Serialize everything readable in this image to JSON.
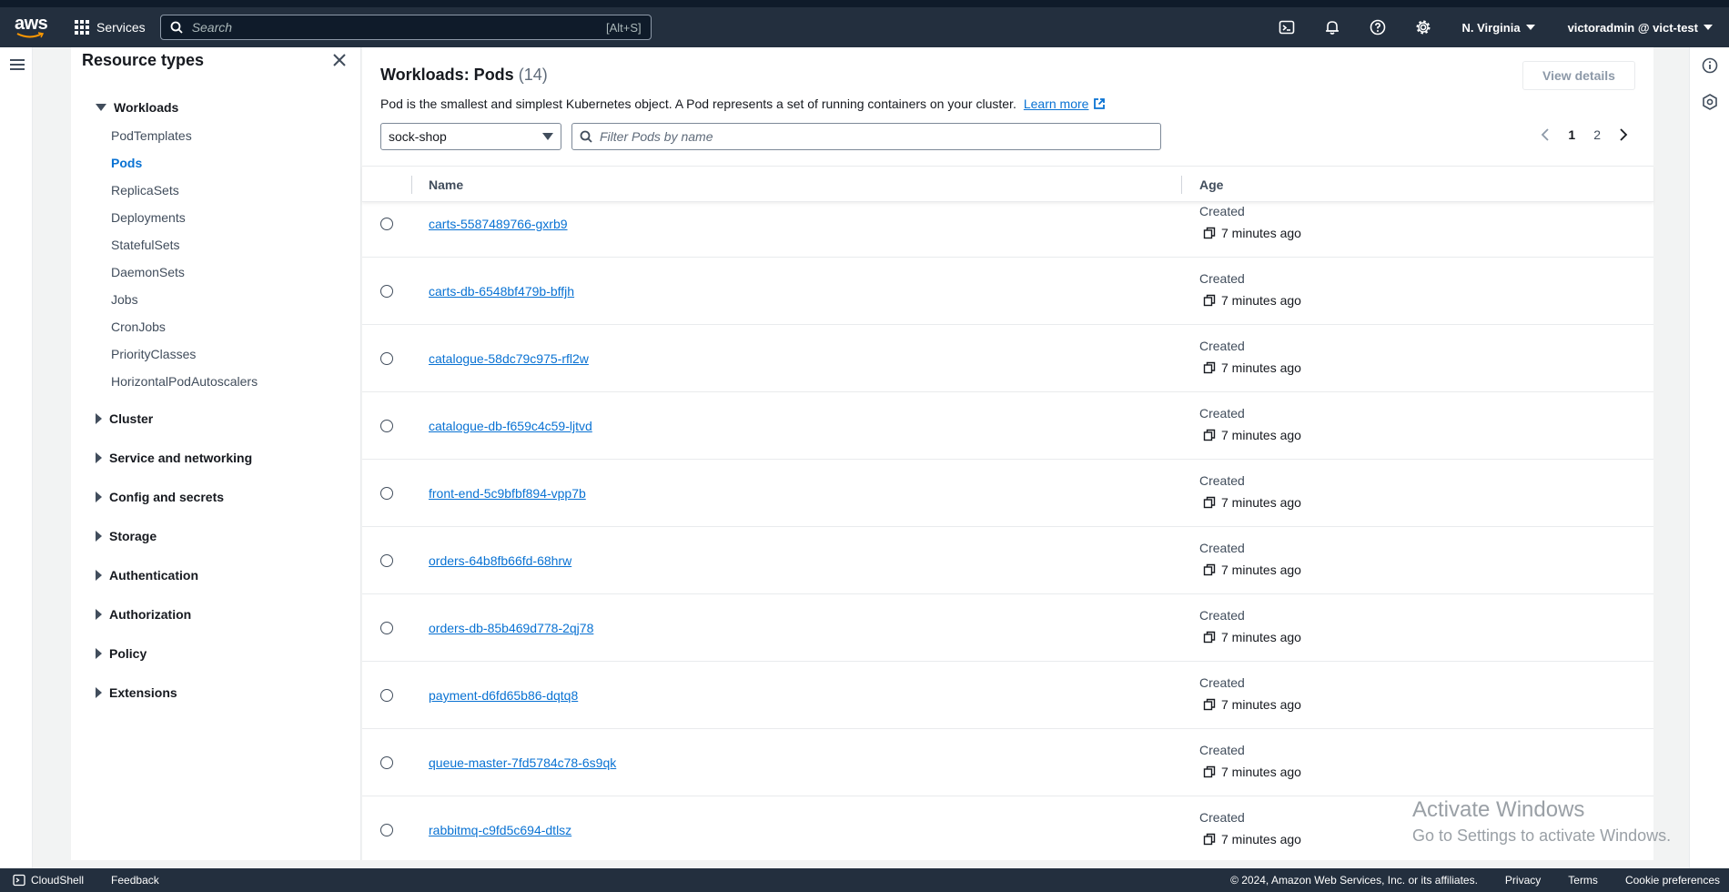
{
  "topnav": {
    "logo": "aws",
    "services_label": "Services",
    "search_placeholder": "Search",
    "search_shortcut": "[Alt+S]",
    "region": "N. Virginia",
    "user": "victoradmin @ vict-test",
    "icons": [
      "cloudshell-icon",
      "bell-icon",
      "help-icon",
      "gear-icon"
    ]
  },
  "sidebar": {
    "title": "Resource types",
    "workloads_label": "Workloads",
    "workload_items": [
      {
        "label": "PodTemplates",
        "active": false
      },
      {
        "label": "Pods",
        "active": true
      },
      {
        "label": "ReplicaSets",
        "active": false
      },
      {
        "label": "Deployments",
        "active": false
      },
      {
        "label": "StatefulSets",
        "active": false
      },
      {
        "label": "DaemonSets",
        "active": false
      },
      {
        "label": "Jobs",
        "active": false
      },
      {
        "label": "CronJobs",
        "active": false
      },
      {
        "label": "PriorityClasses",
        "active": false
      },
      {
        "label": "HorizontalPodAutoscalers",
        "active": false
      }
    ],
    "groups": [
      "Cluster",
      "Service and networking",
      "Config and secrets",
      "Storage",
      "Authentication",
      "Authorization",
      "Policy",
      "Extensions"
    ]
  },
  "main": {
    "title": "Workloads: Pods",
    "count": "(14)",
    "view_details": "View details",
    "description": "Pod is the smallest and simplest Kubernetes object. A Pod represents a set of running containers on your cluster.",
    "learn_more": "Learn more",
    "namespace": "sock-shop",
    "filter_placeholder": "Filter Pods by name",
    "pages": [
      "1",
      "2"
    ],
    "current_page": "1",
    "columns": {
      "name": "Name",
      "age": "Age"
    },
    "rows": [
      {
        "name": "carts-5587489766-gxrb9",
        "created": "Created",
        "age": "7 minutes ago"
      },
      {
        "name": "carts-db-6548bf479b-bffjh",
        "created": "Created",
        "age": "7 minutes ago"
      },
      {
        "name": "catalogue-58dc79c975-rfl2w",
        "created": "Created",
        "age": "7 minutes ago"
      },
      {
        "name": "catalogue-db-f659c4c59-ljtvd",
        "created": "Created",
        "age": "7 minutes ago"
      },
      {
        "name": "front-end-5c9bfbf894-vpp7b",
        "created": "Created",
        "age": "7 minutes ago"
      },
      {
        "name": "orders-64b8fb66fd-68hrw",
        "created": "Created",
        "age": "7 minutes ago"
      },
      {
        "name": "orders-db-85b469d778-2qj78",
        "created": "Created",
        "age": "7 minutes ago"
      },
      {
        "name": "payment-d6fd65b86-dqtq8",
        "created": "Created",
        "age": "7 minutes ago"
      },
      {
        "name": "queue-master-7fd5784c78-6s9qk",
        "created": "Created",
        "age": "7 minutes ago"
      },
      {
        "name": "rabbitmq-c9fd5c694-dtlsz",
        "created": "Created",
        "age": "7 minutes ago"
      }
    ]
  },
  "watermark": {
    "line1": "Activate Windows",
    "line2": "Go to Settings to activate Windows."
  },
  "footer": {
    "cloudshell": "CloudShell",
    "feedback": "Feedback",
    "copyright": "© 2024, Amazon Web Services, Inc. or its affiliates.",
    "links": [
      "Privacy",
      "Terms",
      "Cookie preferences"
    ]
  },
  "colors": {
    "nav_bg": "#232f3e",
    "link": "#0972d3",
    "active": "#0972d3"
  }
}
